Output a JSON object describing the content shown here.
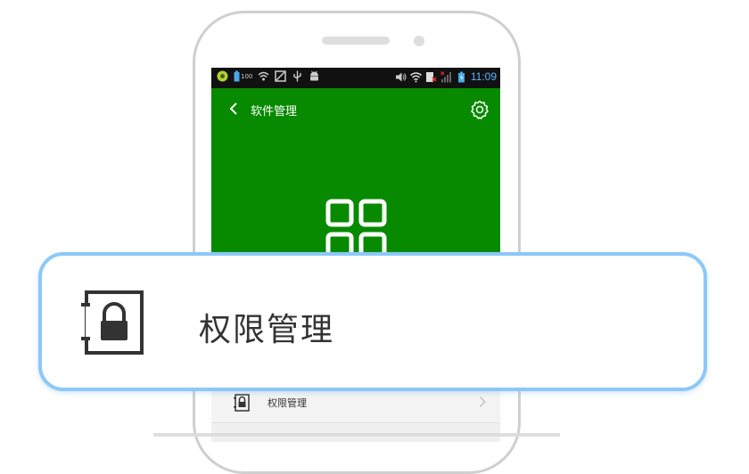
{
  "status_bar": {
    "battery_level_label": "100",
    "time": "11:09"
  },
  "app_bar": {
    "title": "软件管理"
  },
  "menu": {
    "items": [
      {
        "label": "权限管理",
        "icon": "lock-icon"
      }
    ]
  },
  "callout": {
    "label": "权限管理",
    "icon": "lock-icon",
    "border_color": "#8cc8f8"
  },
  "colors": {
    "app_bar": "#078a00",
    "status_bar": "#111111",
    "clock": "#5ab4ff"
  }
}
